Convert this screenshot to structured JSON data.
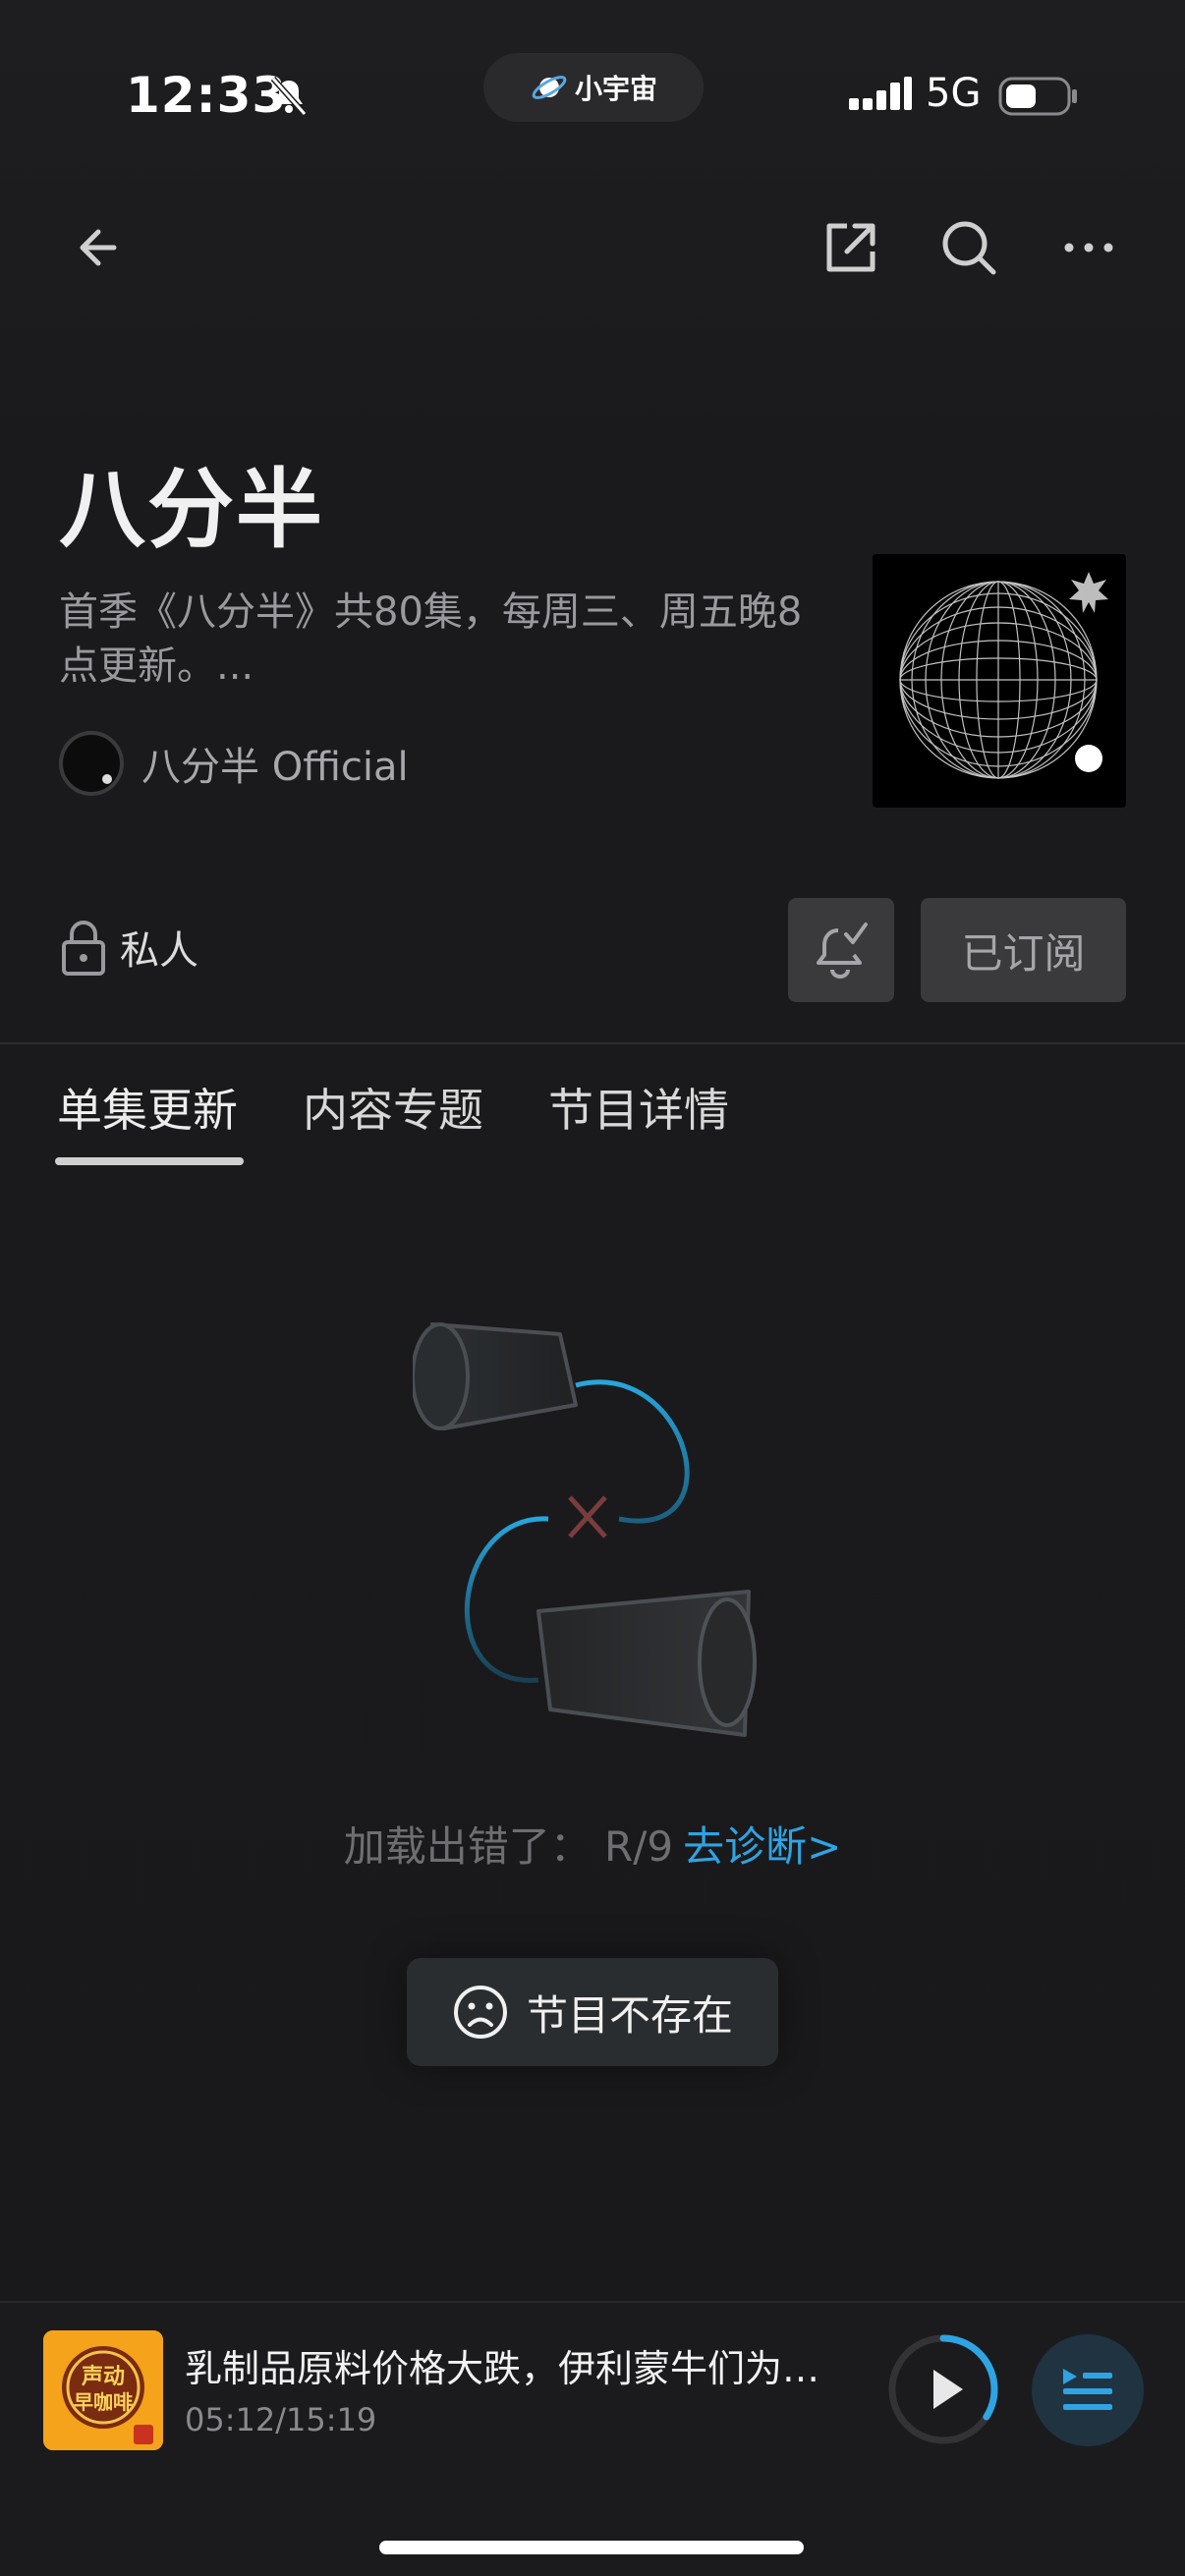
{
  "status_bar": {
    "time": "12:33",
    "app_pill_label": "小宇宙",
    "network": "5G"
  },
  "nav": {
    "back_icon": "arrow-left-icon",
    "share_icon": "share-external-icon",
    "search_icon": "search-icon",
    "more_icon": "more-dots-icon"
  },
  "podcast": {
    "title": "八分半",
    "description": "首季《八分半》共80集，每周三、周五晚8点更新。...",
    "author": "八分半 Official"
  },
  "actions": {
    "private_label": "私人",
    "subscribed_label": "已订阅"
  },
  "tabs": [
    {
      "label": "单集更新",
      "active": true
    },
    {
      "label": "内容专题",
      "active": false
    },
    {
      "label": "节目详情",
      "active": false
    }
  ],
  "empty_state": {
    "error_text": "加载出错了：  R/9",
    "diagnose_link": "去诊断>"
  },
  "toast": {
    "text": "节目不存在",
    "icon": "sad-face-icon"
  },
  "mini_player": {
    "thumb_text_1": "声动",
    "thumb_text_2": "早咖啡",
    "title": "乳制品原料价格大跌，伊利蒙牛们为什么不降价",
    "time": "05:12/15:19",
    "progress": 0.34
  },
  "colors": {
    "accent": "#2ea4e4",
    "background": "#1a1a1c",
    "button_bg": "#3a3a3d"
  }
}
